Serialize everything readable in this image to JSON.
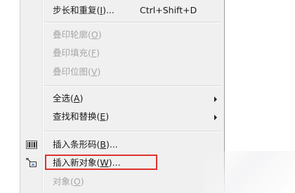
{
  "menu": {
    "step_repeat": {
      "label": "步长和重复(",
      "mnemonic": "I",
      "suffix": ")...",
      "shortcut": "Ctrl+Shift+D"
    },
    "overprint_outline": {
      "label": "叠印轮廓(",
      "mnemonic": "O",
      "suffix": ")"
    },
    "overprint_fill": {
      "label": "叠印填充(",
      "mnemonic": "F",
      "suffix": ")"
    },
    "overprint_bitmap": {
      "label": "叠印位图(",
      "mnemonic": "V",
      "suffix": ")"
    },
    "select_all": {
      "label": "全选(",
      "mnemonic": "A",
      "suffix": ")"
    },
    "find_replace": {
      "label": "查找和替换(",
      "mnemonic": "E",
      "suffix": ")"
    },
    "insert_barcode": {
      "label": "插入条形码(",
      "mnemonic": "B",
      "suffix": ")..."
    },
    "insert_new_object": {
      "label": "插入新对象(",
      "mnemonic": "W",
      "suffix": ")..."
    },
    "object": {
      "label": "对象(",
      "mnemonic": "O",
      "suffix": ")"
    }
  },
  "colors": {
    "highlight_border": "#e0332e",
    "menu_background": "#f0f0f0",
    "disabled_text": "#a6a6a6"
  },
  "icons": {
    "insert_barcode": "barcode-icon",
    "insert_new_object": "insert-object-icon"
  }
}
